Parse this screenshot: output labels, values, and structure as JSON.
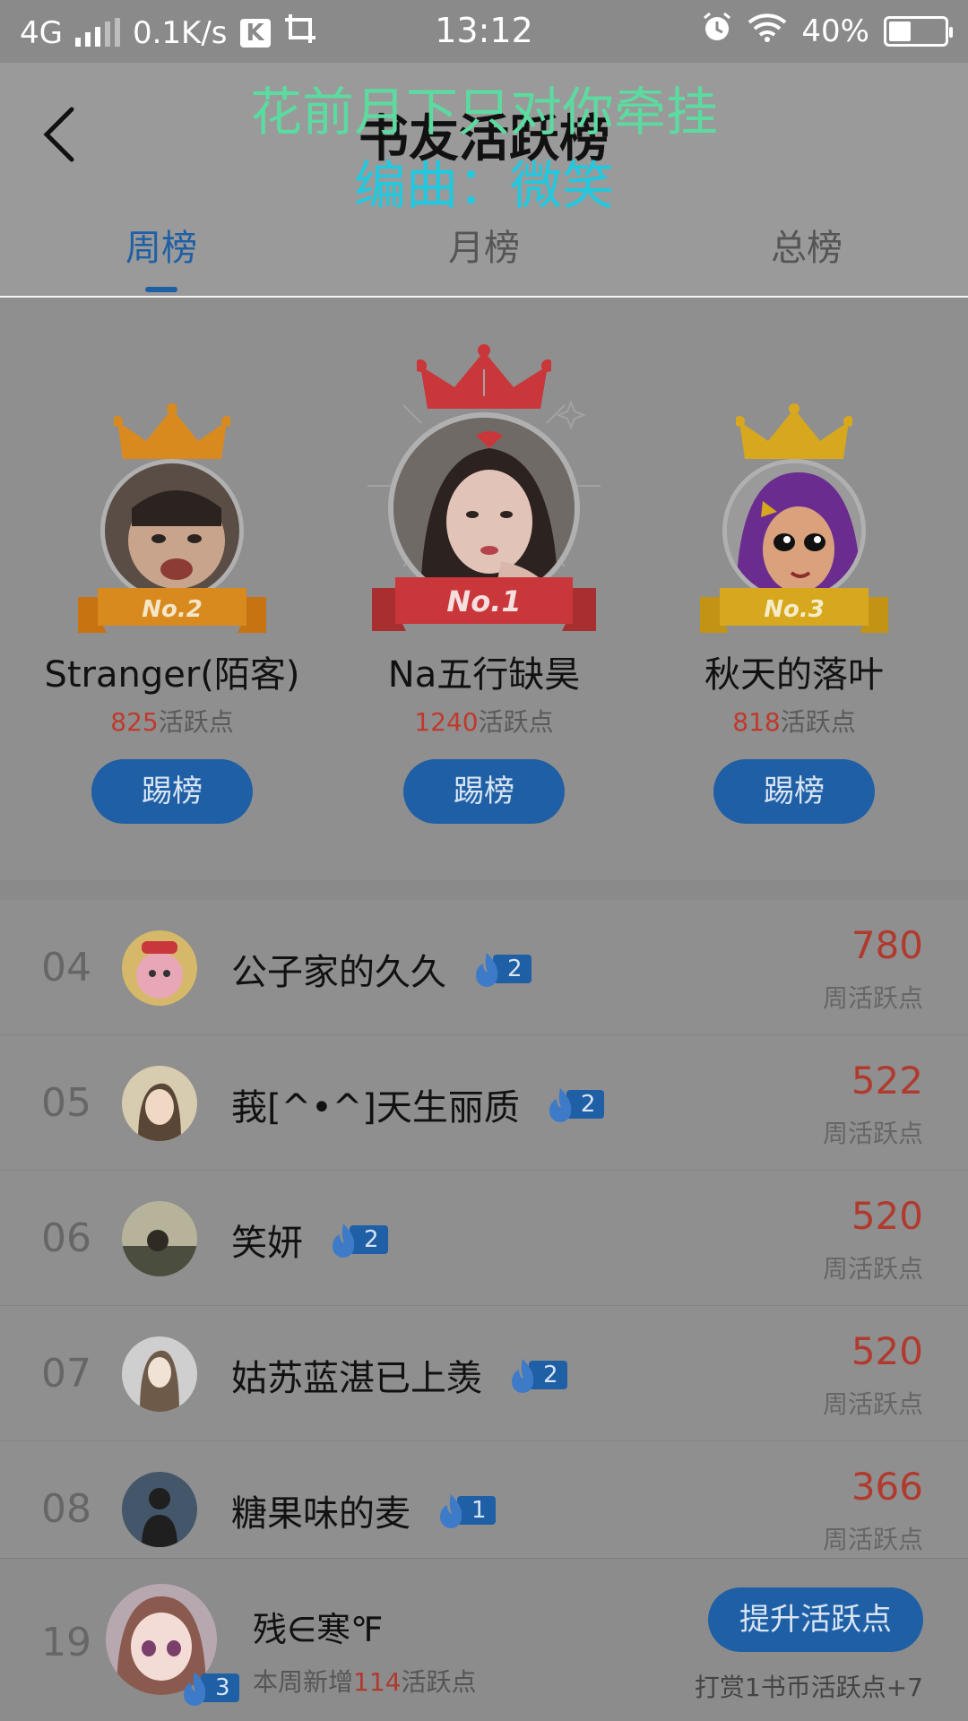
{
  "status_bar": {
    "network": "4G",
    "speed": "0.1K/s",
    "app_badge": "K",
    "time": "13:12",
    "battery": "40%",
    "battery_level": 0.4
  },
  "header": {
    "title": "书友活跃榜",
    "lyric_line1": "花前月下只对你牵挂",
    "lyric_line2": "编曲：微笑"
  },
  "tabs": [
    {
      "label": "周榜",
      "active": true
    },
    {
      "label": "月榜",
      "active": false
    },
    {
      "label": "总榜",
      "active": false
    }
  ],
  "podium": [
    {
      "rank_badge": "No.2",
      "name": "Stranger(陌客)",
      "points": "825",
      "points_suffix": "活跃点",
      "button": "踢榜",
      "crown_color": "#d98a1e"
    },
    {
      "rank_badge": "No.1",
      "name": "Na五行缺昊",
      "points": "1240",
      "points_suffix": "活跃点",
      "button": "踢榜",
      "crown_color": "#c9373a"
    },
    {
      "rank_badge": "No.3",
      "name": "秋天的落叶",
      "points": "818",
      "points_suffix": "活跃点",
      "button": "踢榜",
      "crown_color": "#d7a81e"
    }
  ],
  "list": [
    {
      "rank": "04",
      "name": "公子家的久久",
      "level": "2",
      "value": "780",
      "label": "周活跃点"
    },
    {
      "rank": "05",
      "name": "莪[^•^]天生丽质",
      "level": "2",
      "value": "522",
      "label": "周活跃点"
    },
    {
      "rank": "06",
      "name": "笑妍",
      "level": "2",
      "value": "520",
      "label": "周活跃点"
    },
    {
      "rank": "07",
      "name": "姑苏蓝湛已上羡",
      "level": "2",
      "value": "520",
      "label": "周活跃点"
    },
    {
      "rank": "08",
      "name": "糖果味的麦",
      "level": "1",
      "value": "366",
      "label": "周活跃点"
    }
  ],
  "me": {
    "rank": "19",
    "name": "残∈寒℉",
    "level": "3",
    "sub_prefix": "本周新增",
    "sub_num": "114",
    "sub_suffix": "活跃点",
    "raise_button": "提升活跃点",
    "tip": "打赏1书币活跃点+7"
  }
}
